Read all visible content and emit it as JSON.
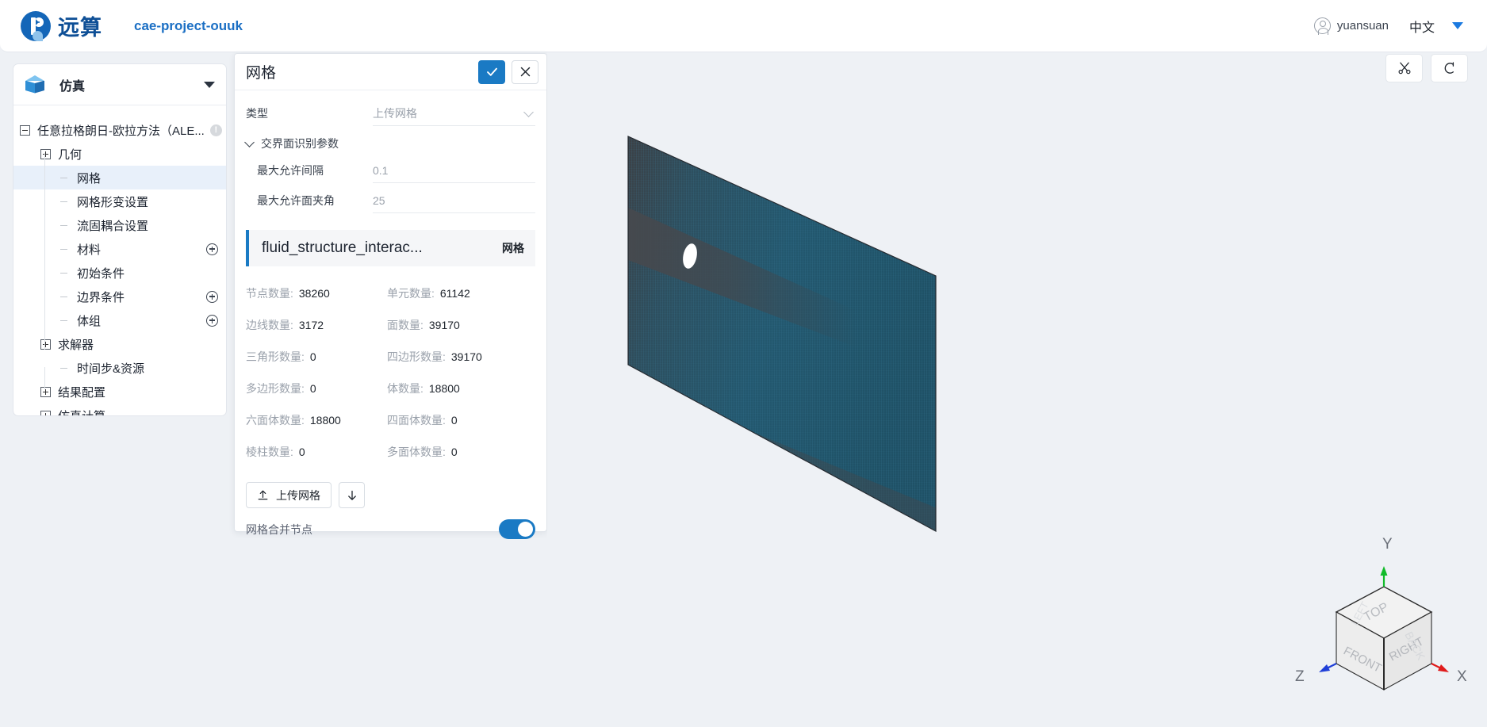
{
  "topbar": {
    "logo_text": "远算",
    "project_name": "cae-project-ouuk",
    "username": "yuansuan",
    "language": "中文"
  },
  "sidebar": {
    "header_title": "仿真",
    "tree": [
      {
        "label": "任意拉格朗日-欧拉方法（ALE...",
        "indent": 0,
        "toggle": "minus",
        "badge": "!",
        "add": false,
        "selected": false
      },
      {
        "label": "几何",
        "indent": 1,
        "toggle": "plus",
        "add": false,
        "selected": false
      },
      {
        "label": "网格",
        "indent": 2,
        "toggle": "dash",
        "add": false,
        "selected": true
      },
      {
        "label": "网格形变设置",
        "indent": 2,
        "toggle": "dash",
        "add": false,
        "selected": false
      },
      {
        "label": "流固耦合设置",
        "indent": 2,
        "toggle": "dash",
        "add": false,
        "selected": false
      },
      {
        "label": "材料",
        "indent": 2,
        "toggle": "dash",
        "add": true,
        "selected": false
      },
      {
        "label": "初始条件",
        "indent": 2,
        "toggle": "dash",
        "add": false,
        "selected": false
      },
      {
        "label": "边界条件",
        "indent": 2,
        "toggle": "dash",
        "add": true,
        "selected": false
      },
      {
        "label": "体组",
        "indent": 2,
        "toggle": "dash",
        "add": true,
        "selected": false
      },
      {
        "label": "求解器",
        "indent": 1,
        "toggle": "plus",
        "add": false,
        "selected": false
      },
      {
        "label": "时间步&资源",
        "indent": 2,
        "toggle": "dash",
        "add": false,
        "selected": false
      },
      {
        "label": "结果配置",
        "indent": 1,
        "toggle": "plus",
        "add": false,
        "selected": false
      },
      {
        "label": "仿真计算",
        "indent": 1,
        "toggle": "plus",
        "add": false,
        "selected": false
      }
    ]
  },
  "panel": {
    "title": "网格",
    "confirm_icon": "check-icon",
    "cancel_icon": "close-icon",
    "type_label": "类型",
    "type_value": "上传网格",
    "group_title": "交界面识别参数",
    "max_gap_label": "最大允许间隔",
    "max_gap_value": "0.1",
    "max_angle_label": "最大允许面夹角",
    "max_angle_value": "25",
    "mesh_card": {
      "name": "fluid_structure_interac...",
      "tag": "网格"
    },
    "stats": [
      {
        "key": "节点数量:",
        "value": "38260"
      },
      {
        "key": "单元数量:",
        "value": "61142"
      },
      {
        "key": "边线数量:",
        "value": "3172"
      },
      {
        "key": "面数量:",
        "value": "39170"
      },
      {
        "key": "三角形数量:",
        "value": "0"
      },
      {
        "key": "四边形数量:",
        "value": "39170"
      },
      {
        "key": "多边形数量:",
        "value": "0"
      },
      {
        "key": "体数量:",
        "value": "18800"
      },
      {
        "key": "六面体数量:",
        "value": "18800"
      },
      {
        "key": "四面体数量:",
        "value": "0"
      },
      {
        "key": "棱柱数量:",
        "value": "0"
      },
      {
        "key": "多面体数量:",
        "value": "0"
      }
    ],
    "upload_button": "上传网格",
    "download_icon": "download-arrow-icon",
    "merge_nodes_label": "网格合并节点",
    "merge_nodes_on": true
  },
  "viewport": {
    "tools": [
      {
        "name": "scissors-icon"
      },
      {
        "name": "rotate-icon"
      }
    ],
    "viewcube": {
      "faces": {
        "top": "TOP",
        "front": "FRONT",
        "right": "RIGHT",
        "back": "BACK",
        "left": "LEFT"
      },
      "axes": {
        "x": "X",
        "y": "Y",
        "z": "Z"
      },
      "axis_colors": {
        "x": "#e01b1b",
        "y": "#12bb2a",
        "z": "#1f3fd8"
      }
    },
    "mesh_colors": {
      "face": "#24576e",
      "shadow": "#4a4d52",
      "hole": "#ffffff",
      "background": "#eef1f5"
    }
  }
}
